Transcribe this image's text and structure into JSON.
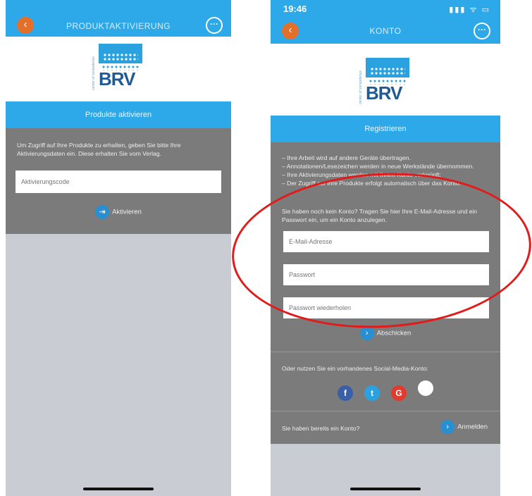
{
  "screen_a": {
    "title": "PRODUKTAKTIVIERUNG",
    "back_glyph": "‹",
    "more_glyph": "···",
    "logo_text": "BRV",
    "logo_tagline": "center of competence",
    "section_title": "Produkte aktivieren",
    "instructions": "Um Zugriff auf Ihre Produkte zu erhalten, geben Sie bitte Ihre Aktivierungsdaten ein. Diese erhalten Sie vom Verlag.",
    "activation_code_placeholder": "Aktivierungscode",
    "activate_label": "Aktivieren",
    "activate_glyph": "⇥"
  },
  "screen_b": {
    "status_time": "19:46",
    "status_icons": "▮▮▮ ᯤ ▭",
    "title": "KONTO",
    "back_glyph": "‹",
    "more_glyph": "···",
    "logo_text": "BRV",
    "logo_tagline": "center of competence",
    "section_title": "Registrieren",
    "benefits": [
      "– Ihre Arbeit wird auf andere Geräte übertragen.",
      "– Annotationen/Lesezeichen werden in neue Werkstände übernommen.",
      "– Ihre Aktivierungsdaten werden mit Ihrem Konto verknüpft:",
      "– Der Zugriff auf Ihre Produkte erfolgt automatisch über das Konto."
    ],
    "signup_prompt": "Sie haben noch kein Konto? Tragen Sie hier Ihre E-Mail-Adresse und ein Passwort ein, um ein Konto anzulegen.",
    "email_placeholder": "E-Mail-Adresse",
    "password_placeholder": "Passwort",
    "password_repeat_placeholder": "Passwort wiederholen",
    "submit_label": "Abschicken",
    "submit_glyph": "›",
    "social_prompt": "Oder nutzen Sie ein vorhandenes Social-Media-Konto:",
    "social": {
      "facebook_glyph": "f",
      "twitter_glyph": "t",
      "google_glyph": "G",
      "apple_glyph": ""
    },
    "login_prompt": "Sie haben bereits ein Konto?",
    "login_label": "Anmelden",
    "login_glyph": "›"
  },
  "colors": {
    "brand_blue": "#2da8e8",
    "back_orange": "#e26f2a",
    "panel_gray": "#7b7b7b",
    "highlight_red": "#e21a1a"
  }
}
